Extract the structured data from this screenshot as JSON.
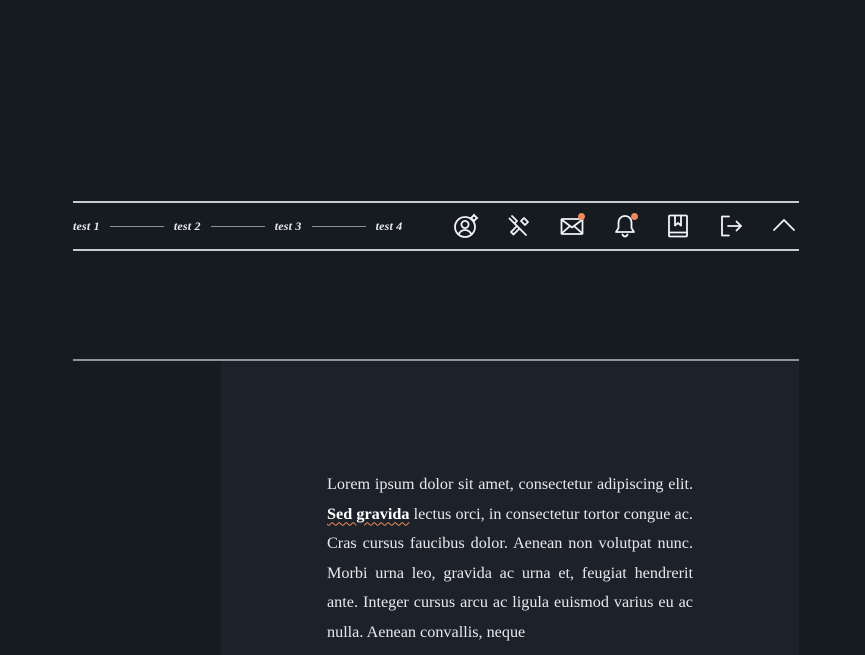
{
  "nav": {
    "steps": [
      "test 1",
      "test 2",
      "test 3",
      "test 4"
    ],
    "icons": [
      {
        "name": "user-settings-icon",
        "badge": false
      },
      {
        "name": "wrench-icon",
        "badge": false
      },
      {
        "name": "mail-icon",
        "badge": true
      },
      {
        "name": "bell-icon",
        "badge": true
      },
      {
        "name": "bookmark-book-icon",
        "badge": false
      },
      {
        "name": "logout-icon",
        "badge": false
      },
      {
        "name": "chevron-up-icon",
        "badge": false
      }
    ],
    "badge_color": "#f08a5d"
  },
  "document": {
    "text_before": "Lorem ipsum dolor sit amet, consectetur adipiscing elit. ",
    "highlight": "Sed gravida",
    "text_after": " lectus orci, in consectetur tortor congue ac. Cras cursus faucibus dolor. Aenean non volutpat nunc. Morbi urna leo, gravida ac urna et, feugiat hendrerit ante. Integer cursus arcu ac ligula euismod varius eu ac nulla. Aenean convallis, neque"
  }
}
